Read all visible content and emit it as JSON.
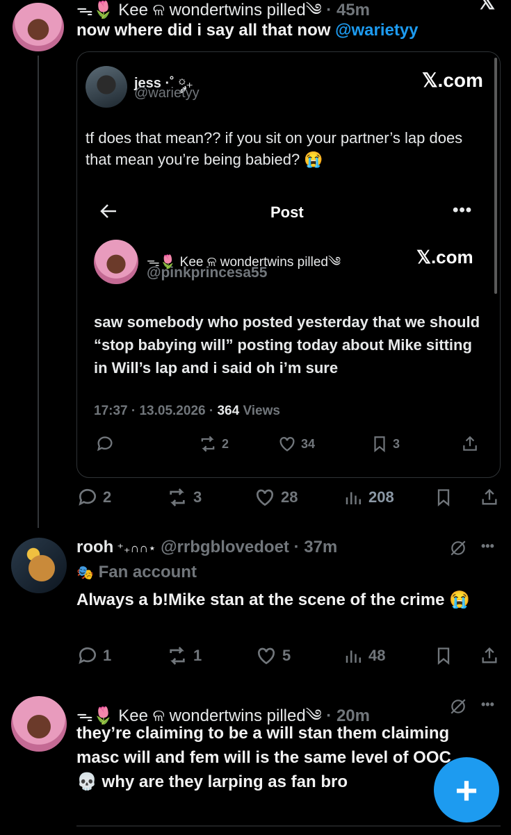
{
  "post1": {
    "display_name": "ᯓ🌷 Kee ଳ wondertwins pilled",
    "emoji_suffix": "༄",
    "time": "· 45m",
    "text_before": "now where did i say all that now ",
    "mention": "@warietyy",
    "close_label": "𝕏"
  },
  "quote_outer": {
    "name": "jess ·˚ ༘",
    "name_suffix": "₊",
    "handle": "@warietyy",
    "source": "𝕏.com",
    "text": "tf does that mean?? if you sit on your partner’s lap does that mean you’re being babied? 😭"
  },
  "quote_inner": {
    "header_title": "Post",
    "name": "ᯓ🌷 Kee ଳ wondertwins pilled༄",
    "handle": "@pinkprincesa55",
    "source": "𝕏.com",
    "text": "saw somebody who posted yesterday that we should “stop babying will” posting today about Mike sitting in Will’s lap and i said oh i’m sure",
    "meta_time": "17:37 · 13.05.2026 · ",
    "views_count": "364",
    "views_label": " Views",
    "replies": "",
    "reposts": "2",
    "likes": "34",
    "bookmarks": "3"
  },
  "post1_actions": {
    "replies": "2",
    "reposts": "3",
    "likes": "28",
    "views": "208"
  },
  "post2": {
    "display_name": "rooh",
    "name_deco": " ⁺₊∩∩⋆",
    "handle": "@rrbgblovedoet",
    "time": "· 37m",
    "badge_icon": "🎭",
    "badge_label": "Fan account",
    "text": "Always a b!Mike stan at the scene of the crime 😭",
    "replies": "1",
    "reposts": "1",
    "likes": "5",
    "views": "48"
  },
  "post3": {
    "display_name": "ᯓ🌷 Kee ଳ wondertwins pilled",
    "emoji_suffix": "༄",
    "time": "· 20m",
    "text": "they’re claiming to be a will stan them claiming masc will and fem will is the same level of OOC💀 why are they larping as fan bro"
  },
  "fab": {
    "label": "+"
  },
  "colors": {
    "accent": "#1d9bf0",
    "muted": "#71767b",
    "background": "#000000"
  }
}
